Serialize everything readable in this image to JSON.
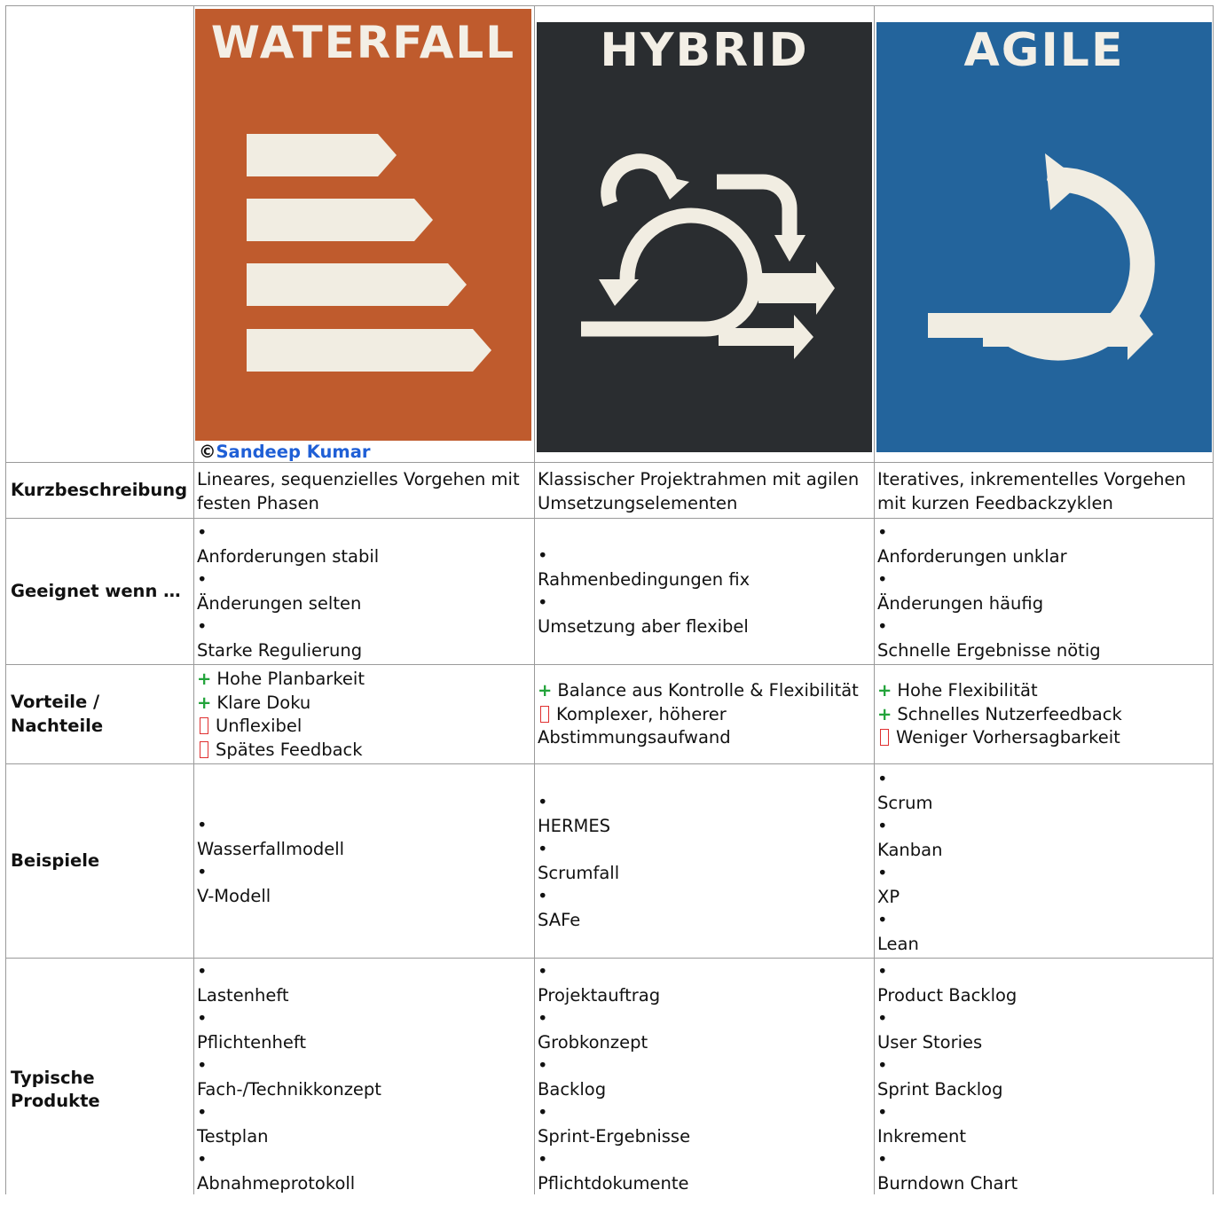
{
  "colors": {
    "waterfall_bg": "#bf5b2d",
    "hybrid_bg": "#2a2d30",
    "agile_bg": "#23649c",
    "icon_fill": "#f1ede2",
    "plus": "#22a33a",
    "minus": "#e03030",
    "link": "#1f5fd6"
  },
  "images": {
    "waterfall": {
      "title": "WATERFALL",
      "icon": "waterfall-steps-icon"
    },
    "hybrid": {
      "title": "HYBRID",
      "icon": "hybrid-loops-icon"
    },
    "agile": {
      "title": "AGILE",
      "icon": "agile-cycle-icon"
    },
    "credit_symbol": "©",
    "credit_name": "Sandeep Kumar"
  },
  "rows": {
    "kurz": {
      "label": "Kurzbeschreibung",
      "waterfall": "Lineares, sequenzielles Vorgehen mit festen Phasen",
      "hybrid": "Klassischer Projektrahmen mit agilen Umsetzungselementen",
      "agile": "Iteratives, inkrementelles Vorgehen mit kurzen Feedbackzyklen"
    },
    "geeignet": {
      "label": "Geeignet wenn …",
      "waterfall": [
        "Anforderungen stabil",
        "Änderungen selten",
        "Starke Regulierung"
      ],
      "hybrid": [
        "Rahmenbedingungen fix",
        "Umsetzung aber flexibel"
      ],
      "agile": [
        "Anforderungen unklar",
        "Änderungen häufig",
        "Schnelle Ergebnisse nötig"
      ]
    },
    "vorteile": {
      "label_1": "Vorteile /",
      "label_2": "Nachteile",
      "plus_sign": "+",
      "waterfall_plus": [
        "Hohe Planbarkeit",
        "Klare Doku"
      ],
      "waterfall_minus": [
        "Unflexibel",
        "Spätes Feedback"
      ],
      "hybrid_plus": [
        "Balance aus Kontrolle & Flexibilität"
      ],
      "hybrid_minus_1": "Komplexer, höherer",
      "hybrid_minus_2": "Abstimmungsaufwand",
      "agile_plus": [
        "Hohe Flexibilität",
        "Schnelles Nutzerfeedback"
      ],
      "agile_minus": [
        "Weniger Vorhersagbarkeit"
      ]
    },
    "beispiele": {
      "label": "Beispiele",
      "waterfall": [
        "Wasserfallmodell",
        "V-Modell"
      ],
      "hybrid": [
        "HERMES",
        "Scrumfall",
        "SAFe"
      ],
      "agile": [
        "Scrum",
        "Kanban",
        "XP",
        "Lean"
      ]
    },
    "produkte": {
      "label_1": "Typische",
      "label_2": "Produkte",
      "waterfall": [
        "Lastenheft",
        "Pflichtenheft",
        "Fach-/Technikkonzept",
        "Testplan",
        "Abnahmeprotokoll"
      ],
      "hybrid": [
        "Projektauftrag",
        "Grobkonzept",
        "Backlog",
        "Sprint-Ergebnisse",
        "Pflichtdokumente"
      ],
      "agile": [
        "Product Backlog",
        "User Stories",
        "Sprint Backlog",
        "Inkrement",
        "Burndown Chart"
      ]
    },
    "bullet": "•"
  }
}
